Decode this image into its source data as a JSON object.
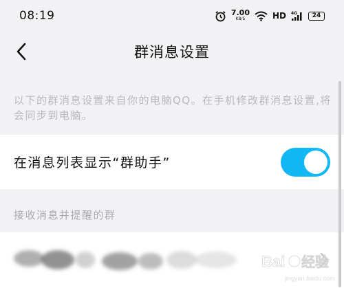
{
  "status": {
    "time": "08:19",
    "speed_value": "7.00",
    "speed_unit": "KB/S",
    "hd_label": "HD",
    "network_label": "4G",
    "battery": "24"
  },
  "nav": {
    "title": "群消息设置"
  },
  "info": {
    "text": "以下的群消息设置来自你的电脑QQ。在手机修改群消息设置,将会同步到电脑。"
  },
  "toggle_row": {
    "label": "在消息列表显示“群助手”",
    "enabled": true
  },
  "section": {
    "header": "接收消息并提醒的群"
  },
  "icons": {
    "back": "back-arrow-icon",
    "alarm": "alarm-icon",
    "wifi": "wifi-icon",
    "signal": "signal-icon",
    "chevron": "chevron-right-icon"
  },
  "colors": {
    "accent": "#12b7f5",
    "background": "#f2f2f5"
  },
  "watermark": {
    "text": "Baidu 经验"
  }
}
